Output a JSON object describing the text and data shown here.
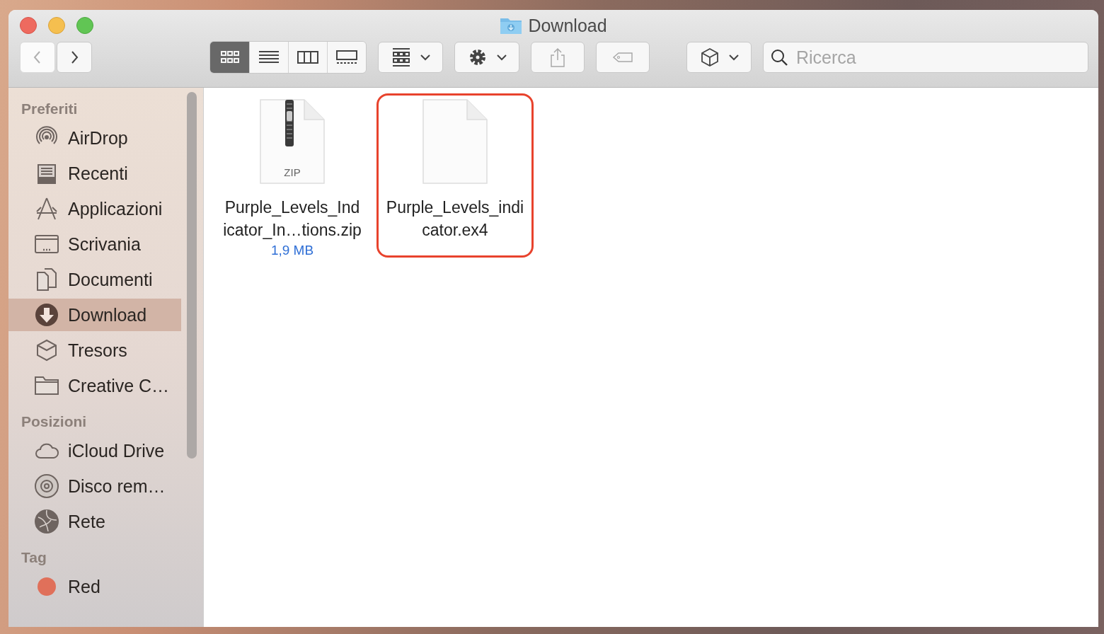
{
  "window": {
    "title": "Download"
  },
  "toolbar": {
    "nav": [
      {
        "kind": "back",
        "disabled": true
      },
      {
        "kind": "forward",
        "disabled": false
      }
    ],
    "views": [
      {
        "kind": "icons",
        "selected": true
      },
      {
        "kind": "list",
        "selected": false
      },
      {
        "kind": "columns",
        "selected": false
      },
      {
        "kind": "gallery",
        "selected": false
      }
    ],
    "tools": [
      {
        "kind": "group",
        "caret": true
      },
      {
        "kind": "action",
        "caret": true
      },
      {
        "kind": "share",
        "caret": false
      },
      {
        "kind": "tag",
        "caret": false
      },
      {
        "kind": "cube",
        "caret": true
      }
    ],
    "search": {
      "placeholder": "Ricerca"
    }
  },
  "sidebar": {
    "sections": [
      {
        "title": "Preferiti",
        "items": [
          {
            "label": "AirDrop",
            "kind": "airdrop",
            "selected": false
          },
          {
            "label": "Recenti",
            "kind": "recent",
            "selected": false
          },
          {
            "label": "Applicazioni",
            "kind": "apps",
            "selected": false
          },
          {
            "label": "Scrivania",
            "kind": "desktop",
            "selected": false
          },
          {
            "label": "Documenti",
            "kind": "documents",
            "selected": false
          },
          {
            "label": "Download",
            "kind": "download",
            "selected": true
          },
          {
            "label": "Tresors",
            "kind": "cube",
            "selected": false
          },
          {
            "label": "Creative C…",
            "kind": "folder",
            "selected": false
          }
        ]
      },
      {
        "title": "Posizioni",
        "items": [
          {
            "label": "iCloud Drive",
            "kind": "cloud",
            "selected": false
          },
          {
            "label": "Disco rem…",
            "kind": "disc",
            "selected": false
          },
          {
            "label": "Rete",
            "kind": "network",
            "selected": false
          }
        ]
      },
      {
        "title": "Tag",
        "items": [
          {
            "label": "Red",
            "kind": "tag",
            "color": "#e0705a",
            "selected": false
          }
        ]
      }
    ]
  },
  "files": [
    {
      "kind": "zip",
      "badge": "ZIP",
      "name_lines": [
        "Purple_Levels_Ind",
        "icator_In…tions.zip"
      ],
      "size": "1,9 MB",
      "highlighted": false
    },
    {
      "kind": "document",
      "name_lines": [
        "Purple_Levels_indi",
        "cator.ex4"
      ],
      "highlighted": true
    }
  ]
}
